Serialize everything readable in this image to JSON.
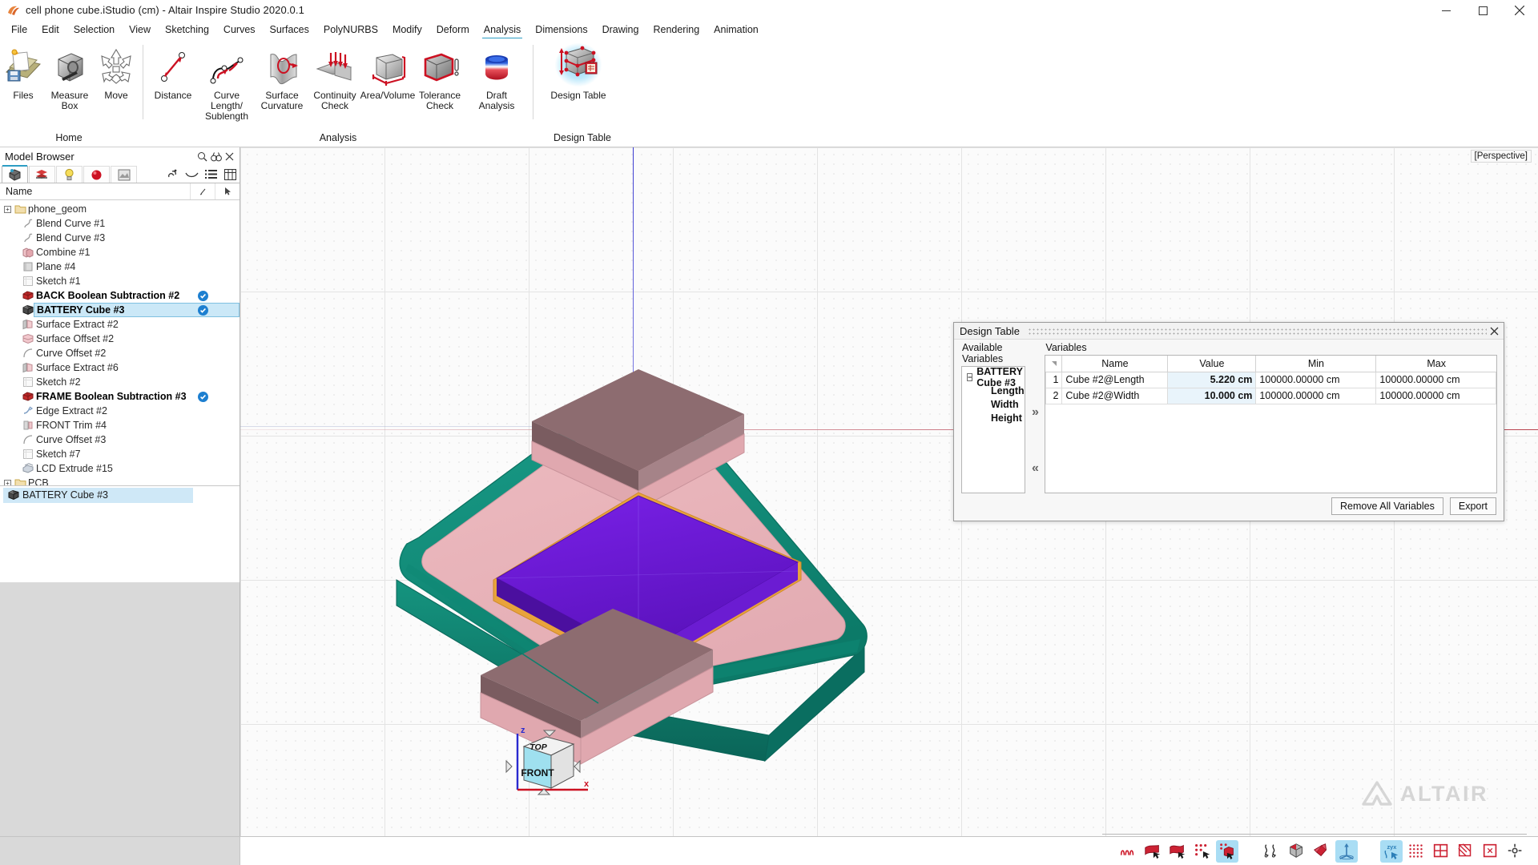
{
  "titlebar": {
    "title": "cell phone cube.iStudio (cm) - Altair Inspire Studio 2020.0.1",
    "app_icon": "altair-studio-icon",
    "minimize": "minimize-icon",
    "maximize": "maximize-icon",
    "close": "close-icon"
  },
  "menubar": {
    "items": [
      {
        "label": "File"
      },
      {
        "label": "Edit"
      },
      {
        "label": "Selection"
      },
      {
        "label": "View"
      },
      {
        "label": "Sketching"
      },
      {
        "label": "Curves"
      },
      {
        "label": "Surfaces"
      },
      {
        "label": "PolyNURBS"
      },
      {
        "label": "Modify"
      },
      {
        "label": "Deform"
      },
      {
        "label": "Analysis"
      },
      {
        "label": "Dimensions"
      },
      {
        "label": "Drawing"
      },
      {
        "label": "Rendering"
      },
      {
        "label": "Animation"
      }
    ],
    "active": "Analysis"
  },
  "ribbon": {
    "group_home_label": "Home",
    "group_analysis_label": "Analysis",
    "group_designtable_label": "Design Table",
    "home_buttons": [
      {
        "label": "Files",
        "icon": "files-icon"
      },
      {
        "label": "Measure Box",
        "icon": "measure-box-icon"
      },
      {
        "label": "Move",
        "icon": "move-icon"
      }
    ],
    "analysis_buttons": [
      {
        "label": "Distance",
        "icon": "distance-icon"
      },
      {
        "label": "Curve Length/ Sublength",
        "icon": "curve-length-icon"
      },
      {
        "label": "Surface Curvature",
        "icon": "surface-curvature-icon"
      },
      {
        "label": "Continuity Check",
        "icon": "continuity-check-icon"
      },
      {
        "label": "Area/Volume",
        "icon": "area-volume-icon"
      },
      {
        "label": "Tolerance Check",
        "icon": "tolerance-check-icon"
      },
      {
        "label": "Draft Analysis",
        "icon": "draft-analysis-icon"
      }
    ],
    "designtable_buttons": [
      {
        "label": "Design Table",
        "icon": "design-table-icon",
        "selected": true
      }
    ]
  },
  "browser": {
    "title": "Model Browser",
    "header_icons": [
      "search-icon",
      "binoculars-icon",
      "close-icon"
    ],
    "tabs": [
      {
        "name": "model-tab",
        "icon": "model-icon",
        "active": true
      },
      {
        "name": "layers-tab",
        "icon": "layers-icon",
        "active": false
      },
      {
        "name": "lights-tab",
        "icon": "bulb-icon",
        "active": false
      },
      {
        "name": "materials-tab",
        "icon": "sphere-icon",
        "active": false
      },
      {
        "name": "render-tab",
        "icon": "render-icon",
        "active": false
      }
    ],
    "tools": [
      "link-icon",
      "curve-icon",
      "list-icon",
      "table-icon"
    ],
    "columns": {
      "name": "Name",
      "col2": "pen-icon",
      "col3": "cursor-icon"
    },
    "tree": [
      {
        "label": "phone_geom",
        "icon": "folder-icon",
        "expand": "+",
        "indent": 0,
        "bold": false,
        "check": false,
        "selected": false
      },
      {
        "label": "Blend Curve #1",
        "icon": "blend-curve-icon",
        "expand": "",
        "indent": 1,
        "bold": false,
        "check": false,
        "selected": false
      },
      {
        "label": "Blend Curve #3",
        "icon": "blend-curve-icon",
        "expand": "",
        "indent": 1,
        "bold": false,
        "check": false,
        "selected": false
      },
      {
        "label": "Combine #1",
        "icon": "combine-icon",
        "expand": "",
        "indent": 1,
        "bold": false,
        "check": false,
        "selected": false
      },
      {
        "label": "Plane #4",
        "icon": "plane-icon",
        "expand": "",
        "indent": 1,
        "bold": false,
        "check": false,
        "selected": false
      },
      {
        "label": "Sketch #1",
        "icon": "sketch-icon",
        "expand": "",
        "indent": 1,
        "bold": false,
        "check": false,
        "selected": false
      },
      {
        "label": "BACK Boolean Subtraction #2",
        "icon": "boolean-icon",
        "expand": "",
        "indent": 1,
        "bold": true,
        "check": true,
        "selected": false
      },
      {
        "label": "BATTERY Cube #3",
        "icon": "cube-icon",
        "expand": "",
        "indent": 1,
        "bold": true,
        "check": true,
        "selected": true
      },
      {
        "label": "Surface Extract #2",
        "icon": "surf-extract-icon",
        "expand": "",
        "indent": 1,
        "bold": false,
        "check": false,
        "selected": false
      },
      {
        "label": "Surface Offset #2",
        "icon": "surf-offset-icon",
        "expand": "",
        "indent": 1,
        "bold": false,
        "check": false,
        "selected": false
      },
      {
        "label": "Curve Offset #2",
        "icon": "curve-offset-icon",
        "expand": "",
        "indent": 1,
        "bold": false,
        "check": false,
        "selected": false
      },
      {
        "label": "Surface Extract #6",
        "icon": "surf-extract-icon",
        "expand": "",
        "indent": 1,
        "bold": false,
        "check": false,
        "selected": false
      },
      {
        "label": "Sketch #2",
        "icon": "sketch-icon",
        "expand": "",
        "indent": 1,
        "bold": false,
        "check": false,
        "selected": false
      },
      {
        "label": "FRAME Boolean Subtraction #3",
        "icon": "boolean-icon",
        "expand": "",
        "indent": 1,
        "bold": true,
        "check": true,
        "selected": false
      },
      {
        "label": "Edge Extract #2",
        "icon": "edge-extract-icon",
        "expand": "",
        "indent": 1,
        "bold": false,
        "check": false,
        "selected": false
      },
      {
        "label": "FRONT Trim #4",
        "icon": "trim-icon",
        "expand": "",
        "indent": 1,
        "bold": false,
        "check": false,
        "selected": false
      },
      {
        "label": "Curve Offset #3",
        "icon": "curve-offset-icon",
        "expand": "",
        "indent": 1,
        "bold": false,
        "check": false,
        "selected": false
      },
      {
        "label": "Sketch #7",
        "icon": "sketch-icon",
        "expand": "",
        "indent": 1,
        "bold": false,
        "check": false,
        "selected": false
      },
      {
        "label": "LCD Extrude #15",
        "icon": "extrude-icon",
        "expand": "",
        "indent": 1,
        "bold": false,
        "check": false,
        "selected": false
      },
      {
        "label": "PCB",
        "icon": "folder-icon",
        "expand": "+",
        "indent": 0,
        "bold": false,
        "check": false,
        "selected": false
      }
    ],
    "selection_panel": [
      {
        "label": "BATTERY Cube #3",
        "icon": "cube-icon"
      }
    ]
  },
  "viewport": {
    "perspective_label": "[Perspective]",
    "watermark": "ALTAIR",
    "viewcube": {
      "top": "TOP",
      "front": "FRONT",
      "axis_x": "x",
      "axis_z": "z"
    },
    "nav_buttons": [
      {
        "name": "eye-view-icon",
        "on": false
      },
      {
        "name": "camera-icon",
        "on": false
      },
      {
        "name": "home-view-icon",
        "on": false
      },
      {
        "name": "camera2-icon",
        "on": false
      },
      {
        "name": "section-icon",
        "on": false
      },
      {
        "name": "shade-icon",
        "on": false
      },
      {
        "name": "grid-icon",
        "on": true
      },
      {
        "name": "zoom-icon",
        "on": false
      },
      {
        "name": "rotate-view-icon",
        "on": false
      },
      {
        "name": "globe-icon",
        "on": false
      },
      {
        "name": "orbit-icon",
        "on": false
      }
    ]
  },
  "design_table": {
    "title": "Design Table",
    "close_icon": "close-icon",
    "available_label": "Available Variables",
    "variables_label": "Variables",
    "tree_root": "BATTERY Cube #3",
    "tree_children": [
      "Length",
      "Width",
      "Height"
    ],
    "add_button": "»",
    "remove_button": "«",
    "columns": [
      "Name",
      "Value",
      "Min",
      "Max"
    ],
    "rows": [
      {
        "index": "1",
        "name": "Cube #2@Length",
        "value": "5.220 cm",
        "min": "100000.00000 cm",
        "max": "100000.00000 cm"
      },
      {
        "index": "2",
        "name": "Cube #2@Width",
        "value": "10.000 cm",
        "min": "100000.00000 cm",
        "max": "100000.00000 cm"
      }
    ],
    "remove_all_label": "Remove All Variables",
    "export_label": "Export"
  },
  "statusbar": {
    "buttons": [
      {
        "name": "curve-tool-icon",
        "on": false
      },
      {
        "name": "surface-select-icon",
        "on": false
      },
      {
        "name": "face-select-icon",
        "on": false
      },
      {
        "name": "point-select-icon",
        "on": false
      },
      {
        "name": "body-select-icon",
        "on": true
      },
      {
        "name": "curve-select2-icon",
        "on": false
      },
      {
        "name": "cube-select-icon",
        "on": false
      },
      {
        "name": "polynurbs-select-icon",
        "on": false
      },
      {
        "name": "axis-tripod-icon",
        "on": true
      },
      {
        "name": "zyx-snap-icon",
        "on": true
      },
      {
        "name": "grid-snap-icon",
        "on": false
      },
      {
        "name": "plane-snap-icon",
        "on": false
      },
      {
        "name": "mesh-snap-icon",
        "on": false
      },
      {
        "name": "box-snap-icon",
        "on": false
      },
      {
        "name": "origin-snap-icon",
        "on": false
      }
    ]
  },
  "colors": {
    "accent": "#2d9dc4",
    "selection_blue": "#cbe8f7",
    "phone_frame": "#0f8a7a",
    "phone_body": "#e8b7bc",
    "screen": "#6a1fd0",
    "screen_border": "#e8a33c",
    "check_blue": "#1d7fd0"
  }
}
